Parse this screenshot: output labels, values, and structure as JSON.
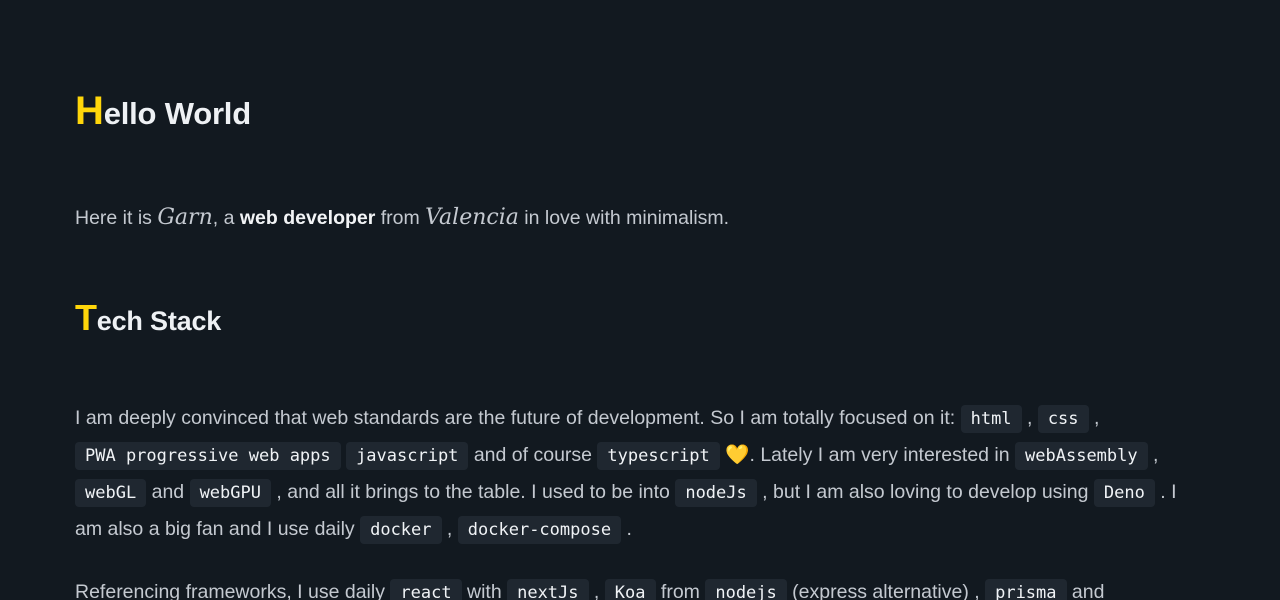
{
  "hero": {
    "title_initial": "H",
    "title_rest": "ello World"
  },
  "intro": {
    "prefix": "Here it is ",
    "name": "Garn",
    "mid1": ", a ",
    "role": "web developer",
    "mid2": " from ",
    "city": "Valencia",
    "suffix": " in love with minimalism."
  },
  "tech": {
    "title_initial": "T",
    "title_rest": "ech Stack",
    "p1": {
      "t1": "I am deeply convinced that web standards are the future of development. So I am totally focused on it: ",
      "c_html": "html",
      "sep1": " , ",
      "c_css": "css",
      "sep2": " , ",
      "c_pwa": "PWA progressive web apps",
      "sep3": " ",
      "c_js": "javascript",
      "t2": " and of course ",
      "c_ts": "typescript",
      "heart": " 💛",
      "t3": ". Lately I am very interested in ",
      "c_wasm": "webAssembly",
      "sep4": " , ",
      "c_webgl": "webGL",
      "t4": " and ",
      "c_webgpu": "webGPU",
      "t5": " , and all it brings to the table. I used to be into ",
      "c_node": "nodeJs",
      "t6": " , but I am also loving to develop using ",
      "c_deno": "Deno",
      "t7": " . I am also a big fan and I use daily ",
      "c_docker": "docker",
      "sep5": " , ",
      "c_compose": "docker-compose",
      "t8": " ."
    },
    "p2": {
      "t1": "Referencing frameworks, I use daily ",
      "c_react": "react",
      "t2": " with ",
      "c_next": "nextJs",
      "sep1": " , ",
      "c_koa": "Koa",
      "t3": " from ",
      "c_nodejs": "nodejs",
      "t4": " (express alternative) , ",
      "c_prisma": "prisma",
      "t5": " and"
    }
  }
}
